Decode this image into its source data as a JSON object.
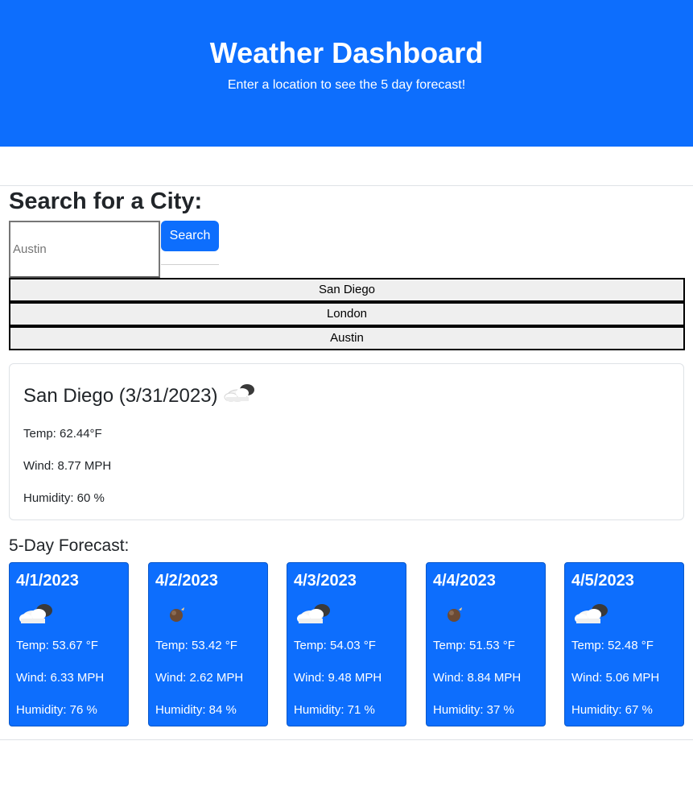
{
  "header": {
    "title": "Weather Dashboard",
    "subtitle": "Enter a location to see the 5 day forecast!"
  },
  "search": {
    "heading": "Search for a City:",
    "placeholder": "Austin",
    "button_label": "Search"
  },
  "history": [
    "San Diego",
    "London",
    "Austin"
  ],
  "current": {
    "title": "San Diego (3/31/2023)",
    "icon": "cloud-icon",
    "temp": "Temp: 62.44°F",
    "wind": "Wind: 8.77 MPH",
    "humidity": "Humidity: 60 %"
  },
  "forecast": {
    "heading": "5-Day Forecast:",
    "days": [
      {
        "date": "4/1/2023",
        "icon": "partly-cloudy-icon",
        "temp": "Temp: 53.67 °F",
        "wind": "Wind: 6.33 MPH",
        "humidity": "Humidity: 76 %"
      },
      {
        "date": "4/2/2023",
        "icon": "rain-drop-icon",
        "temp": "Temp: 53.42 °F",
        "wind": "Wind: 2.62 MPH",
        "humidity": "Humidity: 84 %"
      },
      {
        "date": "4/3/2023",
        "icon": "partly-cloudy-icon",
        "temp": "Temp: 54.03 °F",
        "wind": "Wind: 9.48 MPH",
        "humidity": "Humidity: 71 %"
      },
      {
        "date": "4/4/2023",
        "icon": "rain-drop-icon",
        "temp": "Temp: 51.53 °F",
        "wind": "Wind: 8.84 MPH",
        "humidity": "Humidity: 37 %"
      },
      {
        "date": "4/5/2023",
        "icon": "partly-cloudy-icon",
        "temp": "Temp: 52.48 °F",
        "wind": "Wind: 5.06 MPH",
        "humidity": "Humidity: 67 %"
      }
    ]
  },
  "colors": {
    "primary": "#0d6efd",
    "text": "#212529"
  }
}
